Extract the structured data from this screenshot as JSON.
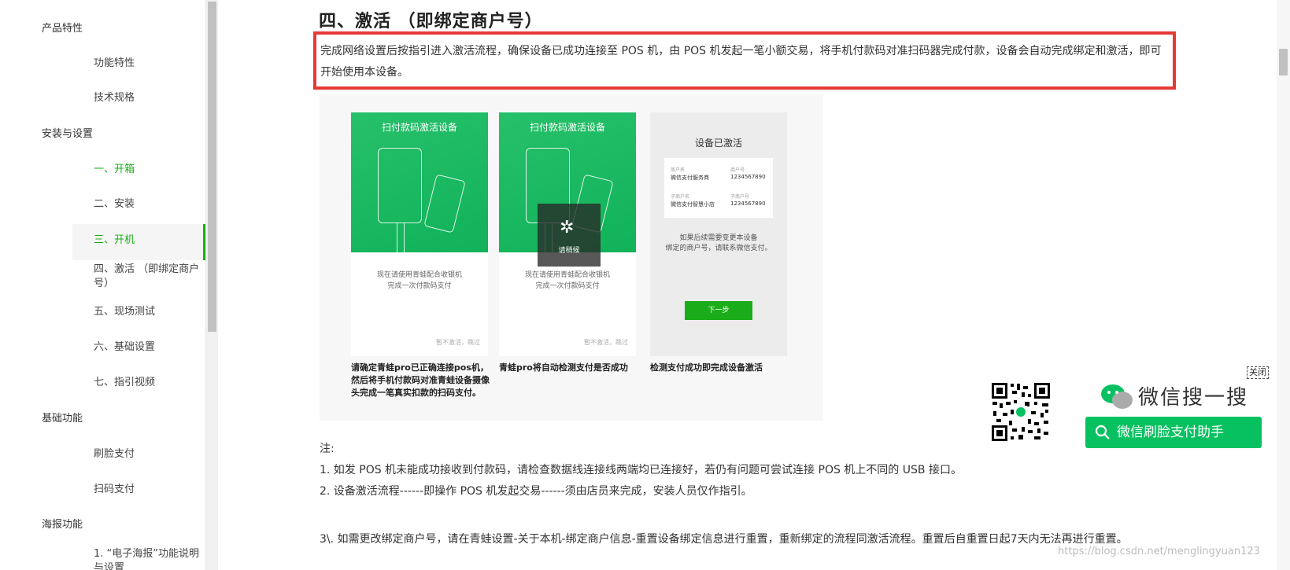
{
  "sidebar": {
    "items": [
      {
        "label": "产品特性",
        "level": "group"
      },
      {
        "label": "功能特性",
        "level": "sub"
      },
      {
        "label": "技术规格",
        "level": "sub"
      },
      {
        "label": "安装与设置",
        "level": "group"
      },
      {
        "label": "一、开箱",
        "level": "sub",
        "state": "visited"
      },
      {
        "label": "二、安装",
        "level": "sub"
      },
      {
        "label": "三、开机",
        "level": "sub",
        "state": "active"
      },
      {
        "label": "四、激活 （即绑定商户号）",
        "level": "sub"
      },
      {
        "label": "五、现场测试",
        "level": "sub"
      },
      {
        "label": "六、基础设置",
        "level": "sub"
      },
      {
        "label": "七、指引视频",
        "level": "sub"
      },
      {
        "label": "基础功能",
        "level": "group"
      },
      {
        "label": "刷脸支付",
        "level": "sub"
      },
      {
        "label": "扫码支付",
        "level": "sub"
      },
      {
        "label": "海报功能",
        "level": "group"
      },
      {
        "label": "1. “电子海报”功能说明与设置",
        "level": "sub"
      }
    ]
  },
  "main": {
    "title": "四、激活 （即绑定商户号）",
    "intro": "完成网络设置后按指引进入激活流程，确保设备已成功连接至 POS 机，由 POS 机发起一笔小额交易，将手机付款码对准扫码器完成付款，设备会自动完成绑定和激活，即可开始使用本设备。",
    "screens": [
      {
        "title": "扫付款码激活设备",
        "caption_line1": "现在请使用青蛙配合收银机",
        "caption_line2": "完成一次付款码支付",
        "skip": "暂不激活，跳过",
        "below": "请确定青蛙pro已正确连接pos机，然后将手机付款码对准青蛙设备摄像头完成一笔真实扣款的扫码支付。"
      },
      {
        "title": "扫付款码激活设备",
        "loading": "请稍候",
        "caption_line1": "现在请使用青蛙配合收银机",
        "caption_line2": "完成一次付款码支付",
        "skip": "暂不激活，跳过",
        "below": "青蛙pro将自动检测支付是否成功"
      },
      {
        "title": "设备已激活",
        "card": {
          "l1": "商户名",
          "v1": "微信支付服务商",
          "l2": "商户号",
          "v2": "1234567890",
          "l3": "子商户名",
          "v3": "微信支付智慧小店",
          "l4": "子商户号",
          "v4": "1234567890"
        },
        "note_line1": "如果后续需要变更本设备",
        "note_line2": "绑定的商户号，请联系微信支付。",
        "next": "下一步",
        "below": "检测支付成功即完成设备激活"
      }
    ],
    "notes": {
      "heading": "注:",
      "n1": "1. 如发 POS 机未能成功接收到付款码，请检查数据线连接线两端均已连接好，若仍有问题可尝试连接 POS 机上不同的 USB 接口。",
      "n2": "2. 设备激活流程------即操作 POS 机发起交易------须由店员来完成，安装人员仅作指引。",
      "n3": "3\\. 如需更改绑定商户号，请在青蛙设置-关于本机-绑定商户信息-重置设备绑定信息进行重置，重新绑定的流程同激活流程。重置后自重置日起7天内无法再进行重置。"
    }
  },
  "wechat": {
    "close": "关闭",
    "brand": "微信搜一搜",
    "search_label": "微信刷脸支付助手"
  },
  "watermark": "https://blog.csdn.net/menglingyuan123",
  "colors": {
    "accent": "#1aad19",
    "highlight": "#e53935",
    "wechat_green": "#07c160"
  }
}
